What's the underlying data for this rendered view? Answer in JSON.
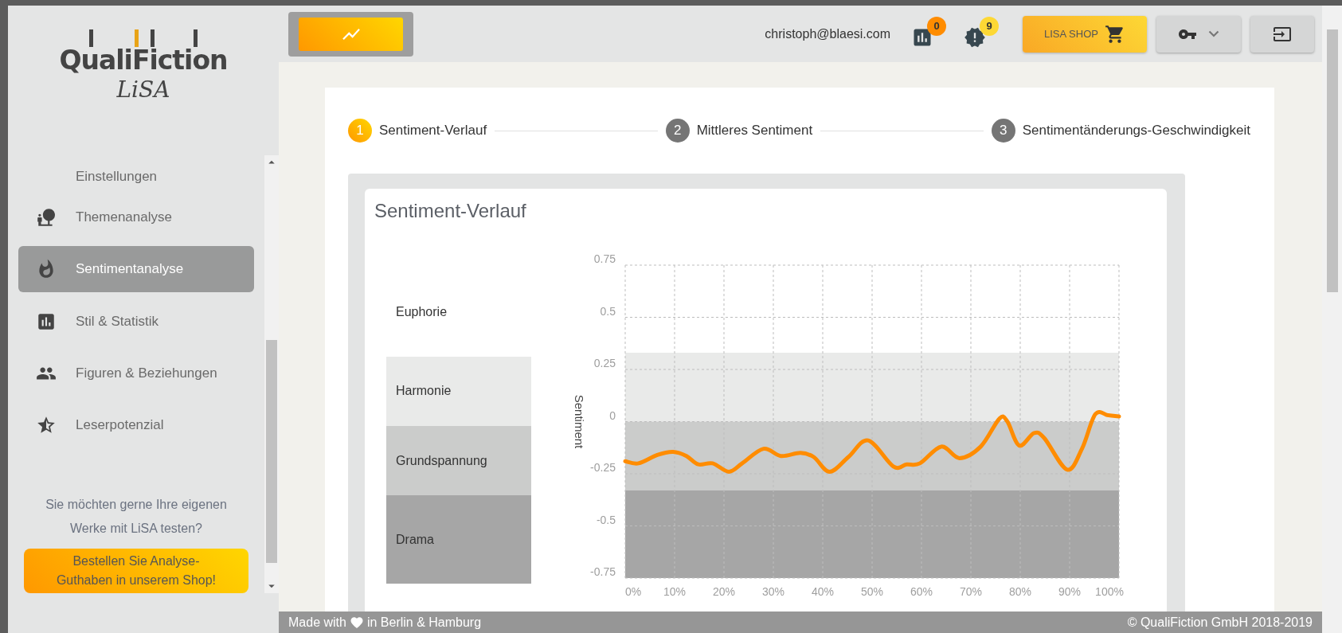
{
  "logo": {
    "name": "QualiFiction",
    "product": "LiSA"
  },
  "sidebar": {
    "items": [
      {
        "label": "Einstellungen",
        "selected": false
      },
      {
        "label": "Themenanalyse",
        "kind": "topics",
        "selected": false
      },
      {
        "label": "Sentimentanalyse",
        "kind": "sentiment",
        "selected": true
      },
      {
        "label": "Stil & Statistik",
        "kind": "statistics",
        "selected": false
      },
      {
        "label": "Figuren & Beziehungen",
        "kind": "characters",
        "selected": false
      },
      {
        "label": "Leserpotenzial",
        "kind": "readers",
        "selected": false
      }
    ],
    "promo": "Sie möchten gerne Ihre eigenen Werke mit LiSA testen?",
    "promo_button": "Bestellen Sie Analyse-Guthaben in unserem Shop!"
  },
  "header": {
    "email": "christoph@blaesi.com",
    "analyses_badge": "0",
    "alerts_badge": "9",
    "shop_button": "LISA SHOP"
  },
  "stepper": [
    {
      "number": "1",
      "label": "Sentiment-Verlauf",
      "selected": true
    },
    {
      "number": "2",
      "label": "Mittleres Sentiment",
      "selected": false
    },
    {
      "number": "3",
      "label": "Sentimentänderungs-Geschwindigkeit",
      "selected": false
    }
  ],
  "chart_card": {
    "title": "Sentiment-Verlauf",
    "top_zone": "Euphorie",
    "chart_data": {
      "type": "line",
      "ylabel": "Sentiment",
      "x": [
        0,
        2.7,
        6.5,
        9.7,
        12.4,
        14.8,
        17.7,
        21,
        23.7,
        28,
        31.5,
        35.5,
        38.2,
        41.4,
        45.2,
        49.2,
        54.3,
        57,
        59.7,
        64,
        67.7,
        72,
        75.8,
        77.4,
        79.8,
        82.8,
        84.9,
        89.5,
        92.5,
        95.2,
        97.8,
        100
      ],
      "series": [
        {
          "color": "#ff8c00",
          "values": [
            -0.19,
            -0.2,
            -0.16,
            -0.145,
            -0.165,
            -0.205,
            -0.2,
            -0.24,
            -0.2,
            -0.13,
            -0.165,
            -0.15,
            -0.17,
            -0.24,
            -0.17,
            -0.09,
            -0.215,
            -0.205,
            -0.2,
            -0.12,
            -0.175,
            -0.12,
            0.015,
            0,
            -0.115,
            -0.055,
            -0.08,
            -0.23,
            -0.13,
            0.035,
            0.03,
            0.025
          ]
        }
      ],
      "xlim": [
        0,
        100
      ],
      "ylim": [
        -0.75,
        0.75
      ],
      "xticks": [
        {
          "value": 0,
          "label": "0%"
        },
        {
          "value": 10,
          "label": "10%"
        },
        {
          "value": 20,
          "label": "20%"
        },
        {
          "value": 30,
          "label": "30%"
        },
        {
          "value": 40,
          "label": "40%"
        },
        {
          "value": 50,
          "label": "50%"
        },
        {
          "value": 60,
          "label": "60%"
        },
        {
          "value": 70,
          "label": "70%"
        },
        {
          "value": 80,
          "label": "80%"
        },
        {
          "value": 90,
          "label": "90%"
        },
        {
          "value": 100,
          "label": "100%"
        }
      ],
      "yticks": [
        {
          "value": 0.75,
          "label": "0.75"
        },
        {
          "value": 0.5,
          "label": "0.5"
        },
        {
          "value": 0.25,
          "label": "0.25"
        },
        {
          "value": 0,
          "label": "0"
        },
        {
          "value": -0.25,
          "label": "-0.25"
        },
        {
          "value": -0.5,
          "label": "-0.5"
        },
        {
          "value": -0.75,
          "label": "-0.75"
        }
      ],
      "grid": true,
      "bands": [
        {
          "axis": "y",
          "label": "Harmonie",
          "from": 0,
          "to": 0.33,
          "color": "#e9eae9"
        },
        {
          "axis": "y",
          "label": "Grundspannung",
          "from": -0.33,
          "to": 0,
          "color": "#cbcccb"
        },
        {
          "axis": "y",
          "label": "Drama",
          "from": -0.75,
          "to": -0.33,
          "color": "#a6a6a6"
        }
      ]
    }
  },
  "footer": {
    "made_with": "Made with",
    "location": "in Berlin & Hamburg",
    "copyright": "© QualiFiction GmbH 2018-2019"
  }
}
